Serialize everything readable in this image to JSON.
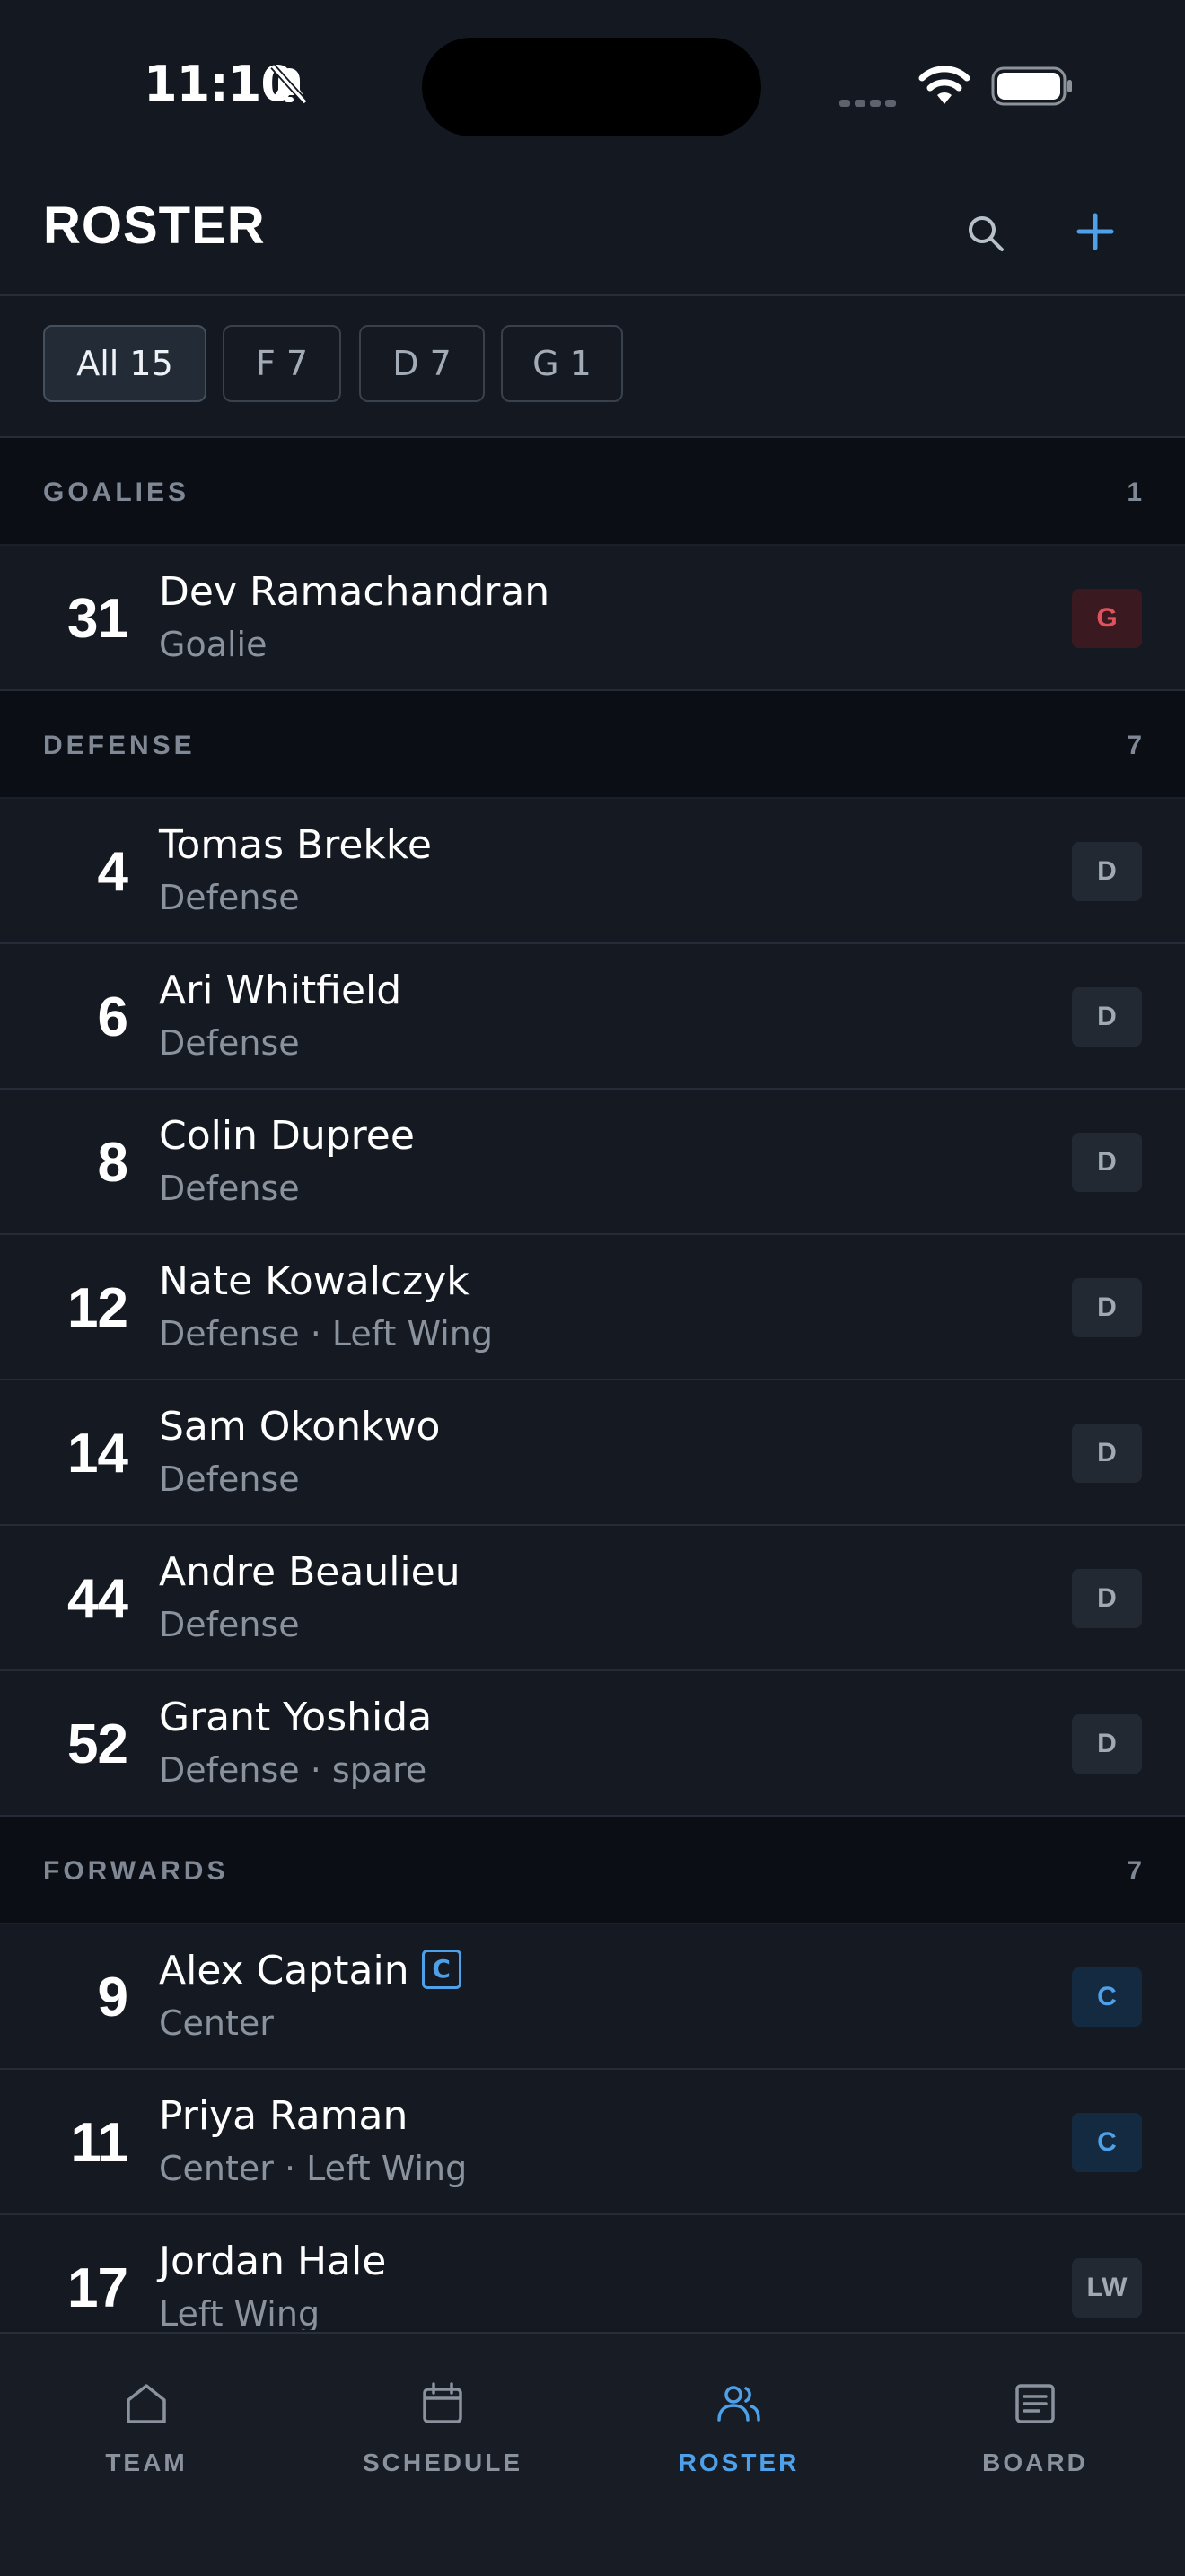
{
  "status_bar": {
    "time": "11:10"
  },
  "header": {
    "title": "ROSTER"
  },
  "filters": [
    {
      "label": "All 15",
      "active": true
    },
    {
      "label": "F 7",
      "active": false
    },
    {
      "label": "D 7",
      "active": false
    },
    {
      "label": "G 1",
      "active": false
    }
  ],
  "sections": [
    {
      "title": "GOALIES",
      "count": "1",
      "players": [
        {
          "number": "31",
          "name": "Dev Ramachandran",
          "position": "Goalie",
          "badge": "G",
          "badge_type": "g",
          "captain": false
        }
      ]
    },
    {
      "title": "DEFENSE",
      "count": "7",
      "players": [
        {
          "number": "4",
          "name": "Tomas Brekke",
          "position": "Defense",
          "badge": "D",
          "badge_type": "d",
          "captain": false
        },
        {
          "number": "6",
          "name": "Ari Whitfield",
          "position": "Defense",
          "badge": "D",
          "badge_type": "d",
          "captain": false
        },
        {
          "number": "8",
          "name": "Colin Dupree",
          "position": "Defense",
          "badge": "D",
          "badge_type": "d",
          "captain": false
        },
        {
          "number": "12",
          "name": "Nate Kowalczyk",
          "position": "Defense · Left Wing",
          "badge": "D",
          "badge_type": "d",
          "captain": false
        },
        {
          "number": "14",
          "name": "Sam Okonkwo",
          "position": "Defense",
          "badge": "D",
          "badge_type": "d",
          "captain": false
        },
        {
          "number": "44",
          "name": "Andre Beaulieu",
          "position": "Defense",
          "badge": "D",
          "badge_type": "d",
          "captain": false
        },
        {
          "number": "52",
          "name": "Grant Yoshida",
          "position": "Defense · spare",
          "badge": "D",
          "badge_type": "d",
          "captain": false
        }
      ]
    },
    {
      "title": "FORWARDS",
      "count": "7",
      "players": [
        {
          "number": "9",
          "name": "Alex Captain",
          "position": "Center",
          "badge": "C",
          "badge_type": "c",
          "captain": true,
          "captain_label": "C"
        },
        {
          "number": "11",
          "name": "Priya Raman",
          "position": "Center · Left Wing",
          "badge": "C",
          "badge_type": "c",
          "captain": false
        },
        {
          "number": "17",
          "name": "Jordan Hale",
          "position": "Left Wing",
          "badge": "LW",
          "badge_type": "lw",
          "captain": false
        }
      ]
    }
  ],
  "tabs": [
    {
      "label": "TEAM",
      "icon": "home-icon",
      "active": false
    },
    {
      "label": "SCHEDULE",
      "icon": "calendar-icon",
      "active": false
    },
    {
      "label": "ROSTER",
      "icon": "people-icon",
      "active": true
    },
    {
      "label": "BOARD",
      "icon": "board-icon",
      "active": false
    }
  ],
  "colors": {
    "accent": "#4ea0e8",
    "background": "#131821",
    "goalie_badge": "#e2525d"
  }
}
